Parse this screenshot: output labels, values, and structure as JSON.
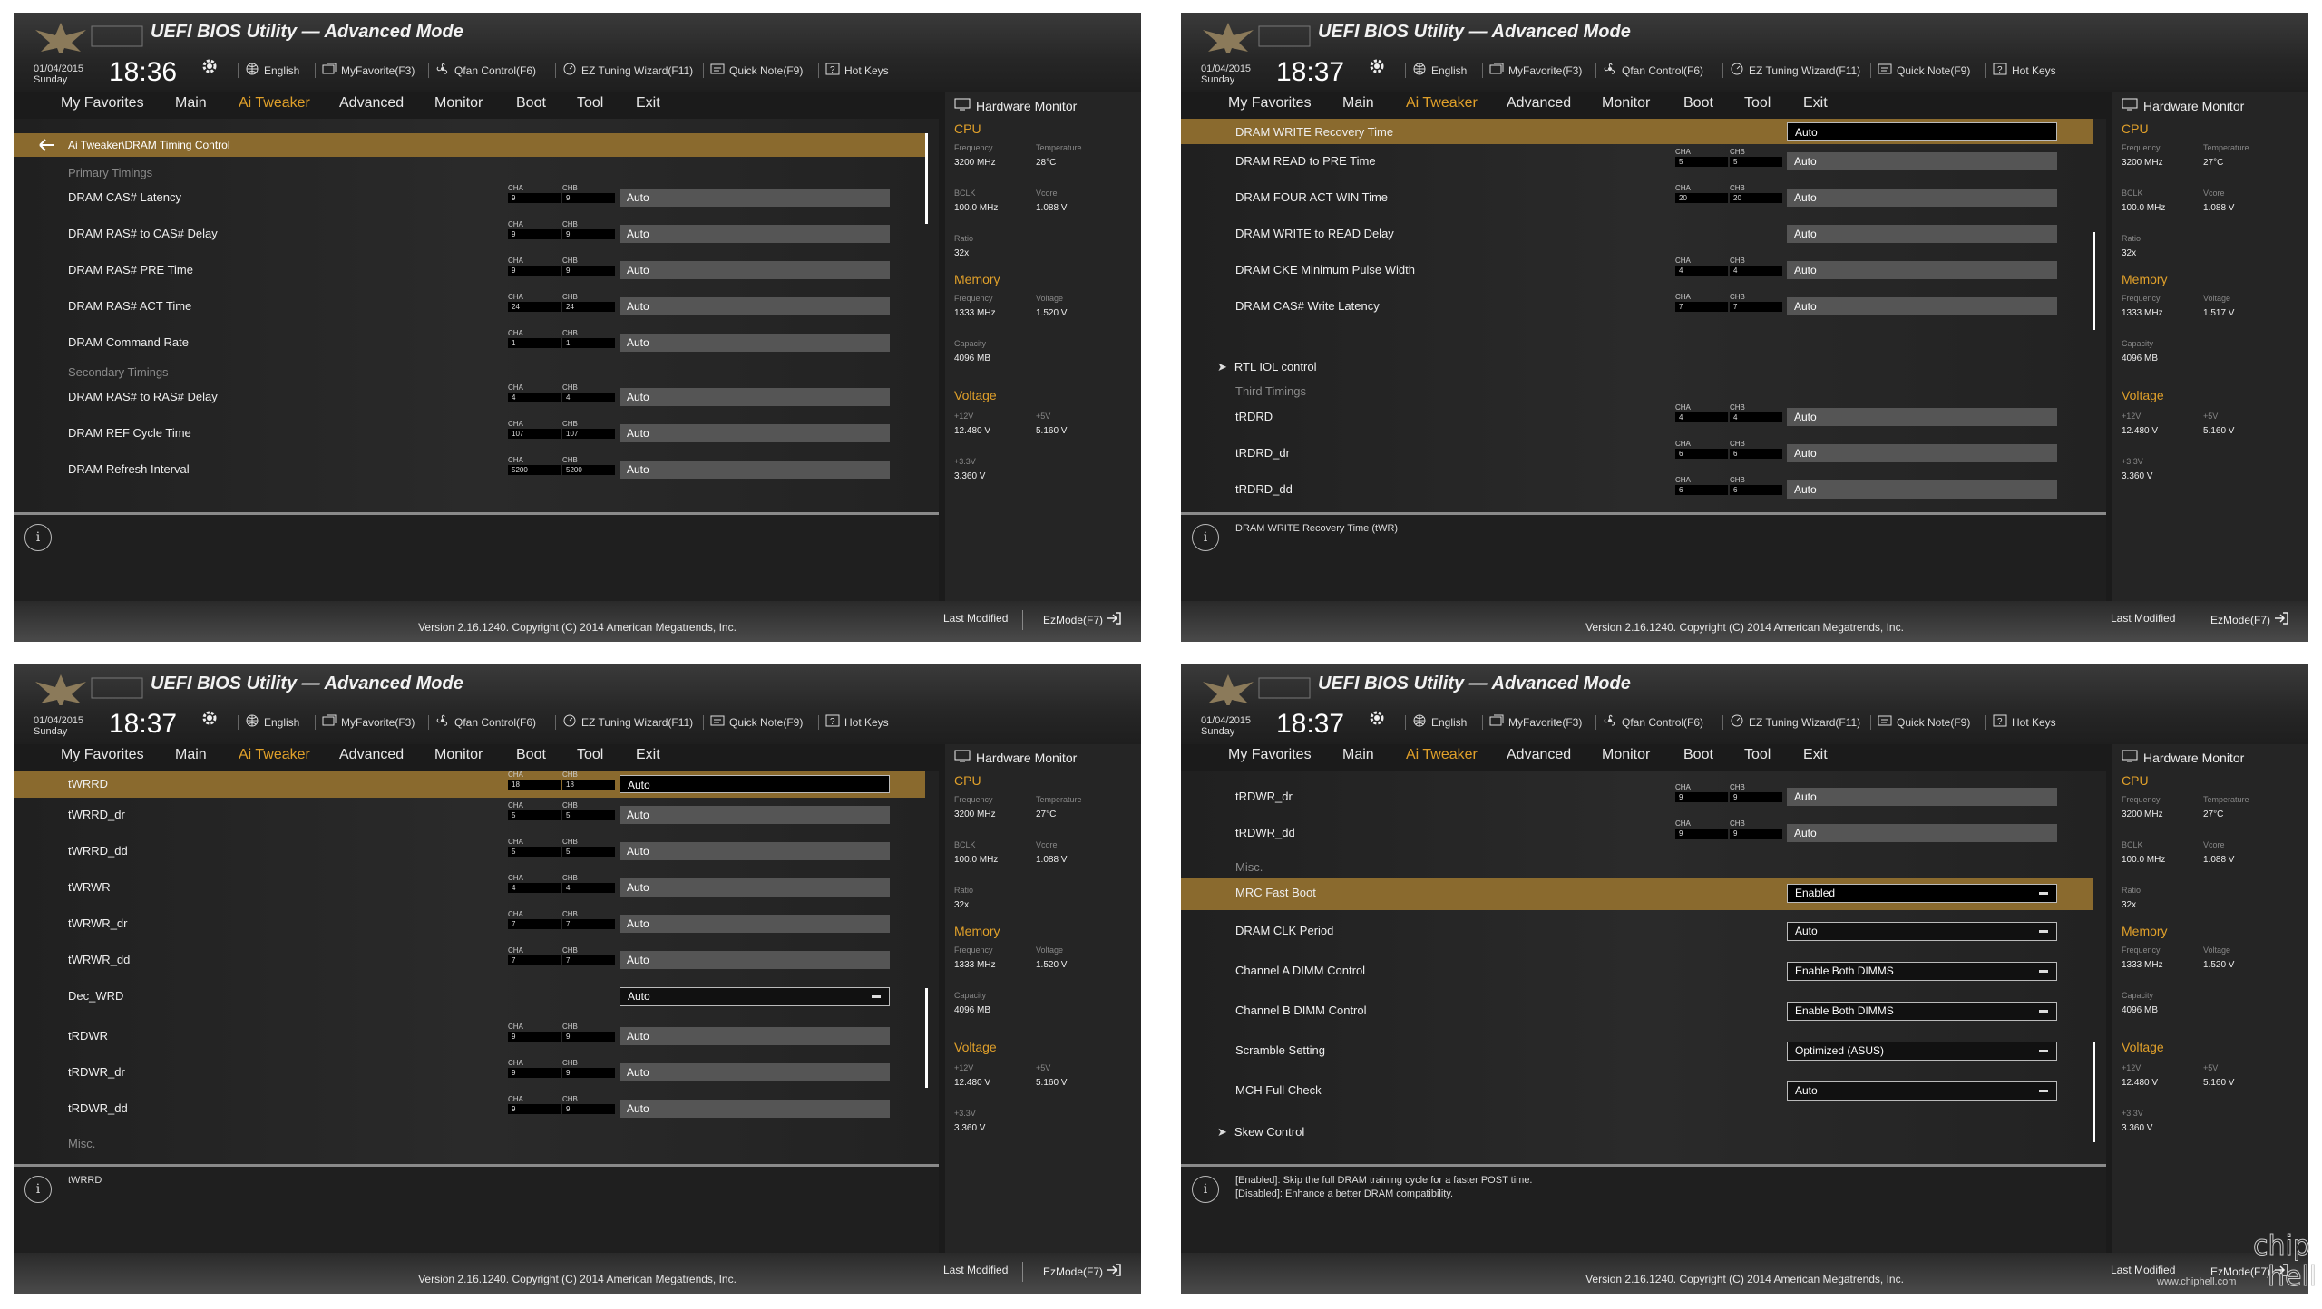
{
  "header": {
    "title": "UEFI BIOS Utility — Advanced Mode",
    "date": "01/04/2015",
    "day": "Sunday",
    "toolbar": [
      "English",
      "MyFavorite(F3)",
      "Qfan Control(F6)",
      "EZ Tuning Wizard(F11)",
      "Quick Note(F9)",
      "Hot Keys"
    ]
  },
  "nav": [
    "My Favorites",
    "Main",
    "Ai Tweaker",
    "Advanced",
    "Monitor",
    "Boot",
    "Tool",
    "Exit"
  ],
  "footer": {
    "last_modified": "Last Modified",
    "ezmode": "EzMode(F7)",
    "version": "Version 2.16.1240. Copyright (C) 2014 American Megatrends, Inc."
  },
  "hw": {
    "title": "Hardware Monitor",
    "cpu": "CPU",
    "memory": "Memory",
    "voltage": "Voltage",
    "frequency": "Frequency",
    "temperature": "Temperature",
    "bclk": "BCLK",
    "vcore": "Vcore",
    "ratio": "Ratio",
    "mvolt": "Voltage",
    "capacity": "Capacity",
    "v12": "+12V",
    "v5": "+5V",
    "v33": "+3.3V",
    "cpu_freq": "3200 MHz",
    "bclk_val": "100.0 MHz",
    "ratio_val": "32x",
    "mem_freq": "1333 MHz",
    "cap_val": "4096 MB",
    "v12_val": "12.480 V",
    "v5_val": "5.160 V",
    "v33_val": "3.360 V"
  },
  "panels": [
    {
      "time": "18:36",
      "breadcrumb": "Ai Tweaker\\DRAM Timing Control",
      "temp": "28°C",
      "vcore": "1.088 V",
      "mvolt": "1.520 V",
      "primary": "Primary Timings",
      "secondary": "Secondary Timings",
      "rows": [
        {
          "label": "DRAM CAS# Latency",
          "a": "9",
          "b": "9",
          "val": "Auto"
        },
        {
          "label": "DRAM RAS# to CAS# Delay",
          "a": "9",
          "b": "9",
          "val": "Auto"
        },
        {
          "label": "DRAM RAS# PRE Time",
          "a": "9",
          "b": "9",
          "val": "Auto"
        },
        {
          "label": "DRAM RAS# ACT Time",
          "a": "24",
          "b": "24",
          "val": "Auto"
        },
        {
          "label": "DRAM Command Rate",
          "a": "1",
          "b": "1",
          "val": "Auto"
        },
        {
          "label": "DRAM RAS# to RAS# Delay",
          "a": "4",
          "b": "4",
          "val": "Auto"
        },
        {
          "label": "DRAM REF Cycle Time",
          "a": "107",
          "b": "107",
          "val": "Auto"
        },
        {
          "label": "DRAM Refresh Interval",
          "a": "5200",
          "b": "5200",
          "val": "Auto"
        }
      ],
      "info": ""
    },
    {
      "time": "18:37",
      "temp": "27°C",
      "vcore": "1.088 V",
      "mvolt": "1.517 V",
      "highlight": {
        "label": "DRAM WRITE Recovery Time",
        "val": "Auto"
      },
      "rows": [
        {
          "label": "DRAM READ to PRE Time",
          "a": "5",
          "b": "5",
          "val": "Auto"
        },
        {
          "label": "DRAM FOUR ACT WIN Time",
          "a": "20",
          "b": "20",
          "val": "Auto"
        },
        {
          "label": "DRAM WRITE to READ Delay",
          "a": "",
          "b": "",
          "val": "Auto"
        },
        {
          "label": "DRAM CKE Minimum Pulse Width",
          "a": "4",
          "b": "4",
          "val": "Auto"
        },
        {
          "label": "DRAM CAS# Write Latency",
          "a": "7",
          "b": "7",
          "val": "Auto"
        },
        {
          "label": "tRDRD",
          "a": "4",
          "b": "4",
          "val": "Auto"
        },
        {
          "label": "tRDRD_dr",
          "a": "6",
          "b": "6",
          "val": "Auto"
        },
        {
          "label": "tRDRD_dd",
          "a": "6",
          "b": "6",
          "val": "Auto"
        }
      ],
      "submenu": "RTL IOL control",
      "third": "Third Timings",
      "info": "DRAM WRITE Recovery Time (tWR)"
    },
    {
      "time": "18:37",
      "temp": "27°C",
      "vcore": "1.088 V",
      "mvolt": "1.520 V",
      "highlight": {
        "label": "tWRRD",
        "a": "18",
        "b": "18",
        "val": "Auto"
      },
      "rows": [
        {
          "label": "tWRRD_dr",
          "a": "5",
          "b": "5",
          "val": "Auto"
        },
        {
          "label": "tWRRD_dd",
          "a": "5",
          "b": "5",
          "val": "Auto"
        },
        {
          "label": "tWRWR",
          "a": "4",
          "b": "4",
          "val": "Auto"
        },
        {
          "label": "tWRWR_dr",
          "a": "7",
          "b": "7",
          "val": "Auto"
        },
        {
          "label": "tWRWR_dd",
          "a": "7",
          "b": "7",
          "val": "Auto"
        },
        {
          "label": "Dec_WRD",
          "val": "Auto"
        },
        {
          "label": "tRDWR",
          "a": "9",
          "b": "9",
          "val": "Auto"
        },
        {
          "label": "tRDWR_dr",
          "a": "9",
          "b": "9",
          "val": "Auto"
        },
        {
          "label": "tRDWR_dd",
          "a": "9",
          "b": "9",
          "val": "Auto"
        }
      ],
      "misc": "Misc.",
      "info": "tWRRD"
    },
    {
      "time": "18:37",
      "temp": "27°C",
      "vcore": "1.088 V",
      "mvolt": "1.520 V",
      "rows": [
        {
          "label": "tRDWR_dr",
          "a": "9",
          "b": "9",
          "val": "Auto"
        },
        {
          "label": "tRDWR_dd",
          "a": "9",
          "b": "9",
          "val": "Auto"
        }
      ],
      "misc": "Misc.",
      "highlight": {
        "label": "MRC Fast Boot",
        "val": "Enabled"
      },
      "dropdowns": [
        {
          "label": "DRAM CLK Period",
          "val": "Auto"
        },
        {
          "label": "Channel A DIMM Control",
          "val": "Enable Both DIMMS"
        },
        {
          "label": "Channel B DIMM Control",
          "val": "Enable Both DIMMS"
        },
        {
          "label": "Scramble Setting",
          "val": "Optimized (ASUS)"
        },
        {
          "label": "MCH Full Check",
          "val": "Auto"
        }
      ],
      "submenu": "Skew Control",
      "info": "[Enabled]: Skip the full DRAM training cycle for a faster POST time.",
      "info2": "[Disabled]: Enhance a better DRAM compatibility."
    }
  ],
  "cha": "CHA",
  "chb": "CHB",
  "watermark_text": "chip hell",
  "watermark_url": "www.chiphell.com"
}
